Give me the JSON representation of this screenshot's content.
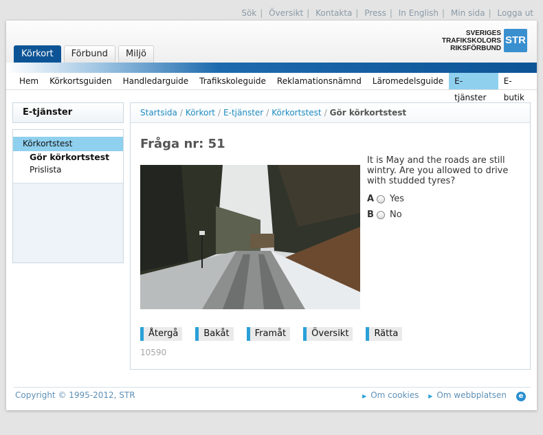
{
  "utility_nav": [
    "Sök",
    "Översikt",
    "Kontakta",
    "Press",
    "In English",
    "Min sida",
    "Logga ut"
  ],
  "tabs": [
    {
      "label": "Körkort",
      "active": true
    },
    {
      "label": "Förbund",
      "active": false
    },
    {
      "label": "Miljö",
      "active": false
    }
  ],
  "logo": {
    "line1": "SVERIGES",
    "line2": "TRAFIKSKOLORS",
    "line3": "RIKSFÖRBUND",
    "mark": "STR"
  },
  "main_nav": [
    {
      "label": "Hem",
      "active": false
    },
    {
      "label": "Körkortsguiden",
      "active": false
    },
    {
      "label": "Handledarguide",
      "active": false
    },
    {
      "label": "Trafikskoleguide",
      "active": false
    },
    {
      "label": "Reklamationsnämnd",
      "active": false
    },
    {
      "label": "Läromedelsguide",
      "active": false
    },
    {
      "label": "E-tjänster",
      "active": true
    },
    {
      "label": "E-butik",
      "active": false
    }
  ],
  "sidebar": {
    "title": "E-tjänster",
    "section": "Körkortstest",
    "items": [
      "Gör körkortstest",
      "Prislista"
    ]
  },
  "breadcrumb": {
    "items": [
      "Startsida",
      "Körkort",
      "E-tjänster",
      "Körkortstest"
    ],
    "current": "Gör körkortstest"
  },
  "quiz": {
    "question_number": "Fråga nr: 51",
    "question_text": "It is May and the roads are still wintry. Are you allowed to drive with studded tyres?",
    "answers": [
      {
        "letter": "A",
        "text": "Yes"
      },
      {
        "letter": "B",
        "text": "No"
      }
    ],
    "buttons": [
      "Återgå",
      "Bakåt",
      "Framåt",
      "Översikt",
      "Rätta"
    ],
    "code": "10590"
  },
  "footer": {
    "copyright": "Copyright © 1995-2012, STR",
    "links": [
      "Om cookies",
      "Om webbplatsen"
    ]
  },
  "colors": {
    "brand_blue": "#0d5496",
    "nav_active": "#8fd0ee",
    "link": "#1e8bc0",
    "button_accent": "#2aa0d8"
  }
}
